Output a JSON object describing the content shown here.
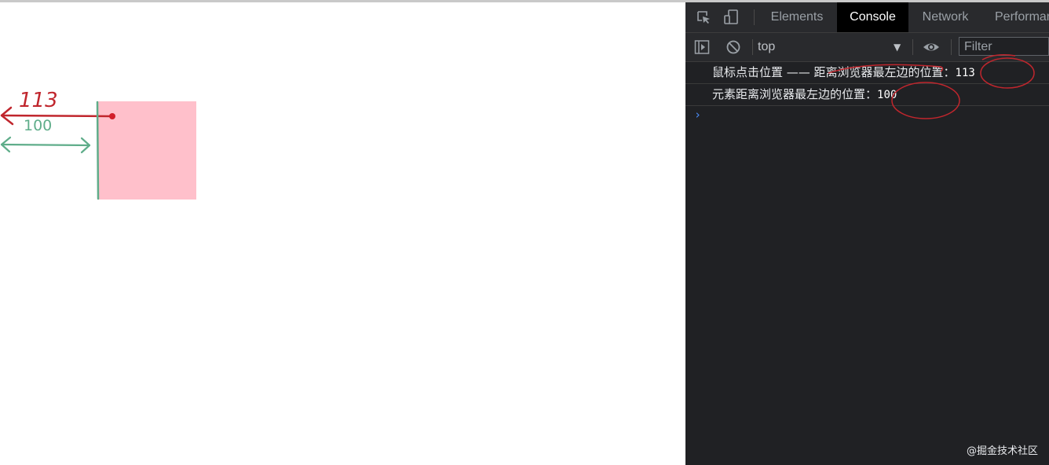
{
  "page": {
    "annotation_distance_click": "113",
    "annotation_distance_element": "100",
    "element_color": "#ffc0cb"
  },
  "devtools": {
    "tabs": [
      {
        "label": "Elements",
        "active": false
      },
      {
        "label": "Console",
        "active": true
      },
      {
        "label": "Network",
        "active": false
      },
      {
        "label": "Performan",
        "active": false
      }
    ],
    "toolbar": {
      "context": "top",
      "filter_placeholder": "Filter"
    },
    "console": {
      "logs": [
        {
          "text": "鼠标点击位置 —— 距离浏览器最左边的位置：",
          "value": "113"
        },
        {
          "text": "元素距离浏览器最左边的位置：",
          "value": "100"
        }
      ],
      "prompt": "›"
    },
    "watermark": "@掘金技术社区"
  },
  "icons": [
    "inspect-element-icon",
    "device-toggle-icon",
    "sidebar-toggle-icon",
    "clear-console-icon",
    "eye-icon",
    "dropdown-arrow-icon",
    "prompt-icon"
  ],
  "colors": {
    "devtools_bg": "#202124",
    "active_tab_bg": "#000000",
    "annotation_red": "#c0262d",
    "annotation_green": "#5fad8a",
    "prompt_blue": "#4a8cf7"
  }
}
